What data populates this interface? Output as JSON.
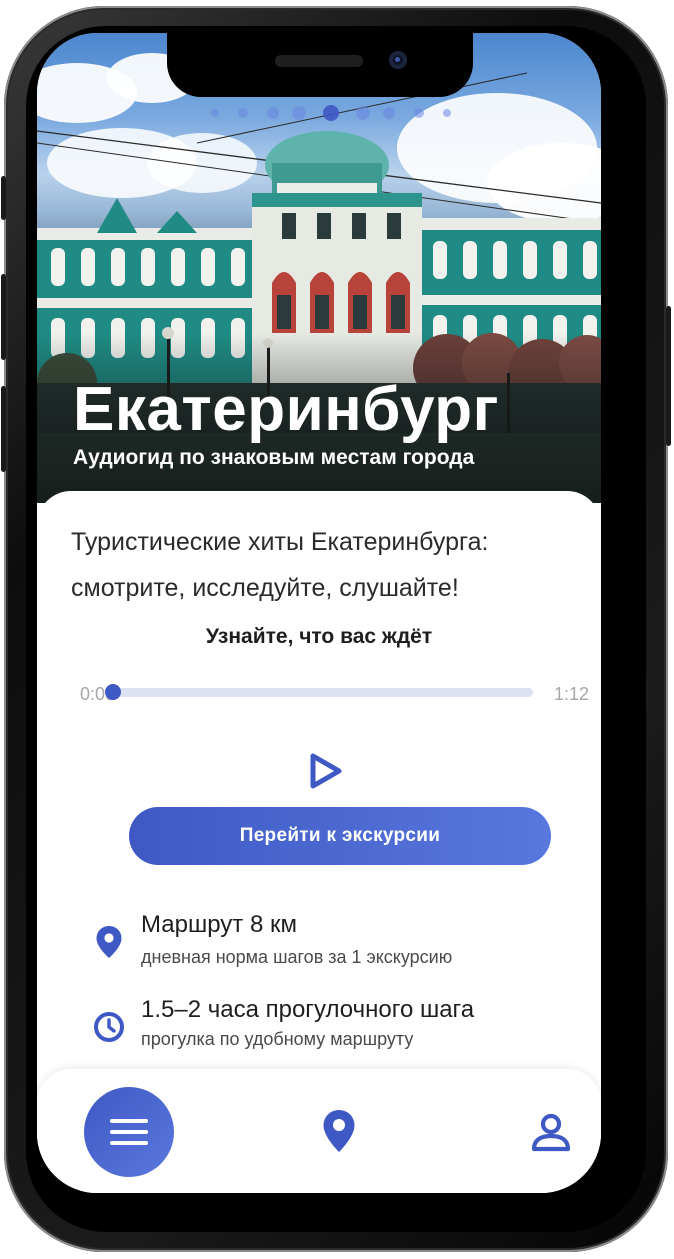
{
  "hero": {
    "title": "Екатеринбург",
    "subtitle": "Аудиогид по знаковым местам города"
  },
  "intro": {
    "text": "Туристические хиты Екатеринбурга: смотрите, исследуйте, слушайте!"
  },
  "audio": {
    "title": "Узнайте, что вас ждёт",
    "current_time": "0:00",
    "total_time": "1:12",
    "progress": 0.0
  },
  "cta": {
    "label": "Перейти к экскурсии"
  },
  "info": [
    {
      "icon": "location-pin-icon",
      "title": "Маршрут 8 км",
      "subtitle": "дневная норма шагов за 1 экскурсию"
    },
    {
      "icon": "clock-icon",
      "title": "1.5–2 часа прогулочного шага",
      "subtitle": "прогулка по удобному маршруту"
    }
  ],
  "bottom_nav": [
    {
      "icon": "menu-icon"
    },
    {
      "icon": "location-pin-icon"
    },
    {
      "icon": "profile-icon"
    }
  ],
  "colors": {
    "accent": "#3f59c4",
    "accent_light": "#5878de",
    "track": "#dde1f4",
    "text": "#1e1e1e"
  }
}
